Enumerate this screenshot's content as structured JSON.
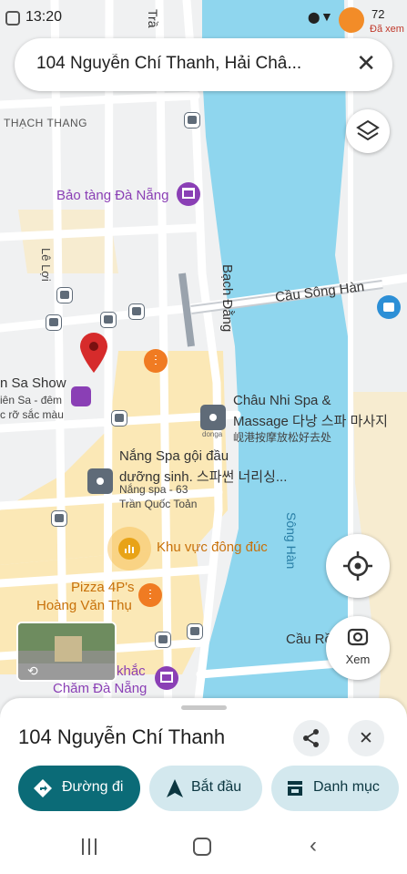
{
  "status_bar": {
    "time": "13:20",
    "right_text": "Đã xem",
    "badge": "72"
  },
  "search": {
    "query": "104 Nguyễn Chí Thanh, Hải Châ..."
  },
  "map_labels": {
    "thach_thang": "THẠCH THANG",
    "bao_tang": "Bảo tàng Đà Nẵng",
    "le_loi": "Lê Lợi",
    "bach_dang": "Bạch Đằng",
    "cau_song_han": "Cầu Sông Hàn",
    "song_han": "Sông Hàn",
    "chau_nhi_1": "Châu Nhi Spa &",
    "chau_nhi_2": "Massage 다낭 스파 마사지",
    "chau_nhi_3": "岘港按摩放松好去处",
    "nang_spa_1": "Nắng Spa gội đầu",
    "nang_spa_2": "dưỡng sinh. 스파썬 너리싱...",
    "nang_spa_3": "Nắng spa - 63",
    "nang_spa_4": "Trần Quốc Toản",
    "busy_area": "Khu vực đông đúc",
    "pizza_1": "Pizza 4P's",
    "pizza_2": "Hoàng Văn Thụ",
    "show_1": "n Sa Show",
    "show_2": "iên Sa - đêm",
    "show_3": "c rỡ sắc màu",
    "cham_1": "khắc",
    "cham_2": "Chăm Đà Nẵng",
    "cau_rong": "Cầu Rồ",
    "tran": "Trầ",
    "d_logo": "donga"
  },
  "buttons": {
    "xem_label": "Xem"
  },
  "sheet": {
    "title": "104 Nguyễn Chí Thanh",
    "chip_directions": "Đường đi",
    "chip_start": "Bắt đầu",
    "chip_category": "Danh mục"
  },
  "colors": {
    "river": "#8fd6ee",
    "primary": "#0b6b77",
    "chip_bg": "#d3e8ee",
    "pin": "#d62b2b"
  }
}
